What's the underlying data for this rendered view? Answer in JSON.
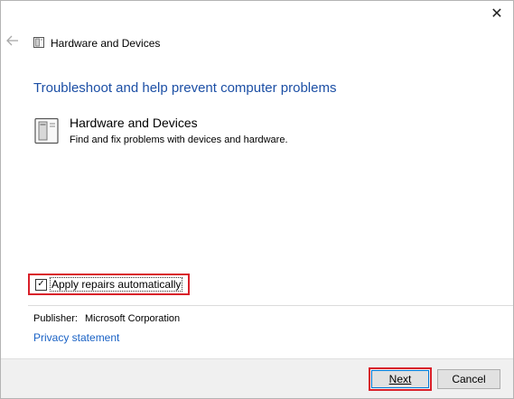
{
  "window": {
    "close_glyph": "✕",
    "title": "Hardware and Devices",
    "back_icon": "back-arrow-icon",
    "title_icon": "hardware-devices-icon"
  },
  "main": {
    "heading": "Troubleshoot and help prevent computer problems",
    "item": {
      "icon": "hardware-devices-icon",
      "title": "Hardware and Devices",
      "description": "Find and fix problems with devices and hardware."
    },
    "apply_repairs": {
      "label": "Apply repairs automatically",
      "checked": true,
      "check_glyph": "✓"
    },
    "publisher": {
      "label": "Publisher:",
      "value": "Microsoft Corporation"
    },
    "privacy_link": "Privacy statement"
  },
  "footer": {
    "next_label": "Next",
    "cancel_label": "Cancel"
  },
  "colors": {
    "heading": "#1c4fa5",
    "link": "#1a62c5",
    "highlight": "#d9202a",
    "footer_bg": "#f0f0f0"
  }
}
